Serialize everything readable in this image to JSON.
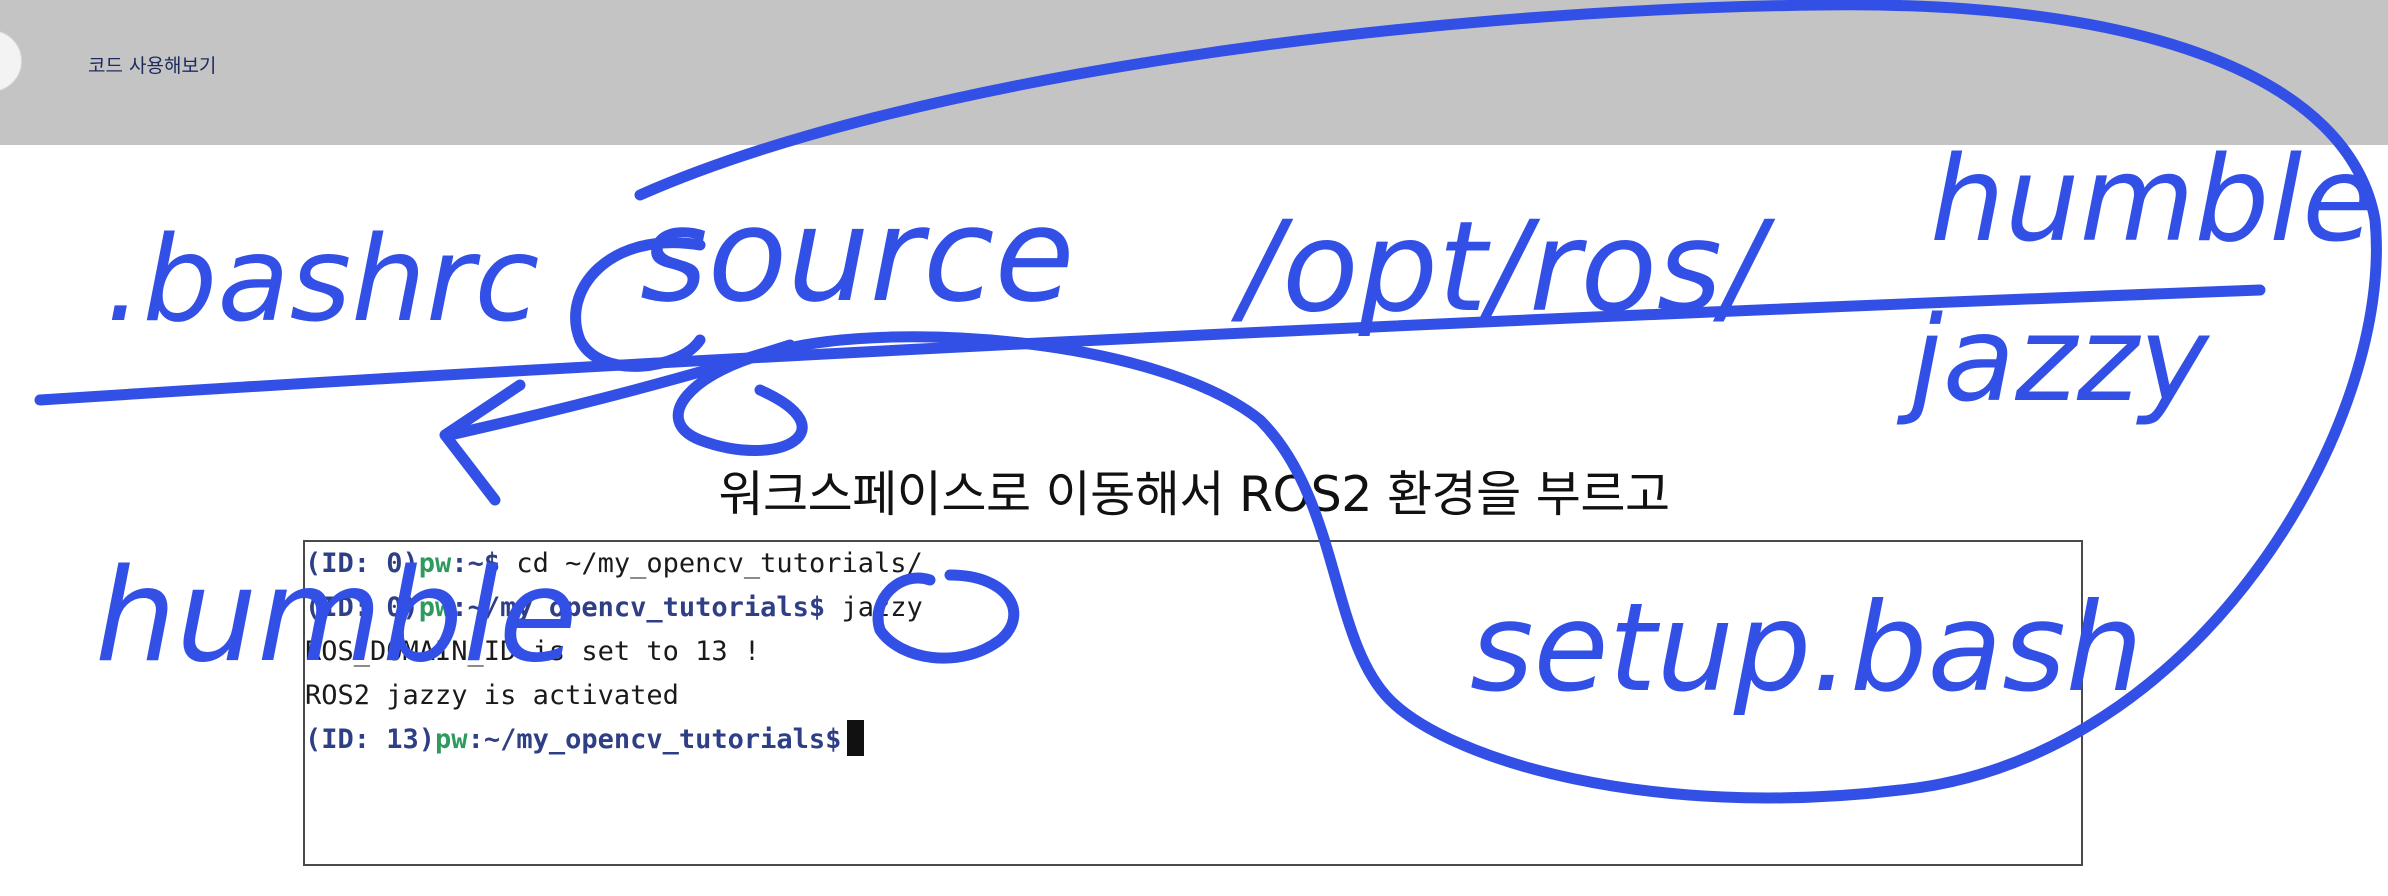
{
  "header": {
    "breadcrumb": "코드 사용해보기"
  },
  "slide": {
    "title": "워크스페이스로 이동해서 ROS2 환경을 부르고"
  },
  "terminal": {
    "lines": [
      {
        "id": "(ID: 0)",
        "user": "pw",
        "path": ":~$",
        "cmd": " cd ~/my_opencv_tutorials/"
      },
      {
        "id": "(ID: 0)",
        "user": "pw",
        "path": ":~/my_opencv_tutorials$",
        "cmd": " jazzy"
      },
      {
        "text": "ROS_DOMAIN_ID is set to 13 !"
      },
      {
        "text": "ROS2 jazzy is activated"
      },
      {
        "id": "(ID: 13)",
        "user": "pw",
        "path": ":~/my_opencv_tutorials$",
        "cmd": " "
      }
    ]
  },
  "annotations": {
    "pen_color": "#3350e6",
    "words": [
      ".bashrc",
      "source",
      "/opt/ros/",
      "humble",
      "jazzy",
      "setup.bash",
      "humble"
    ]
  }
}
